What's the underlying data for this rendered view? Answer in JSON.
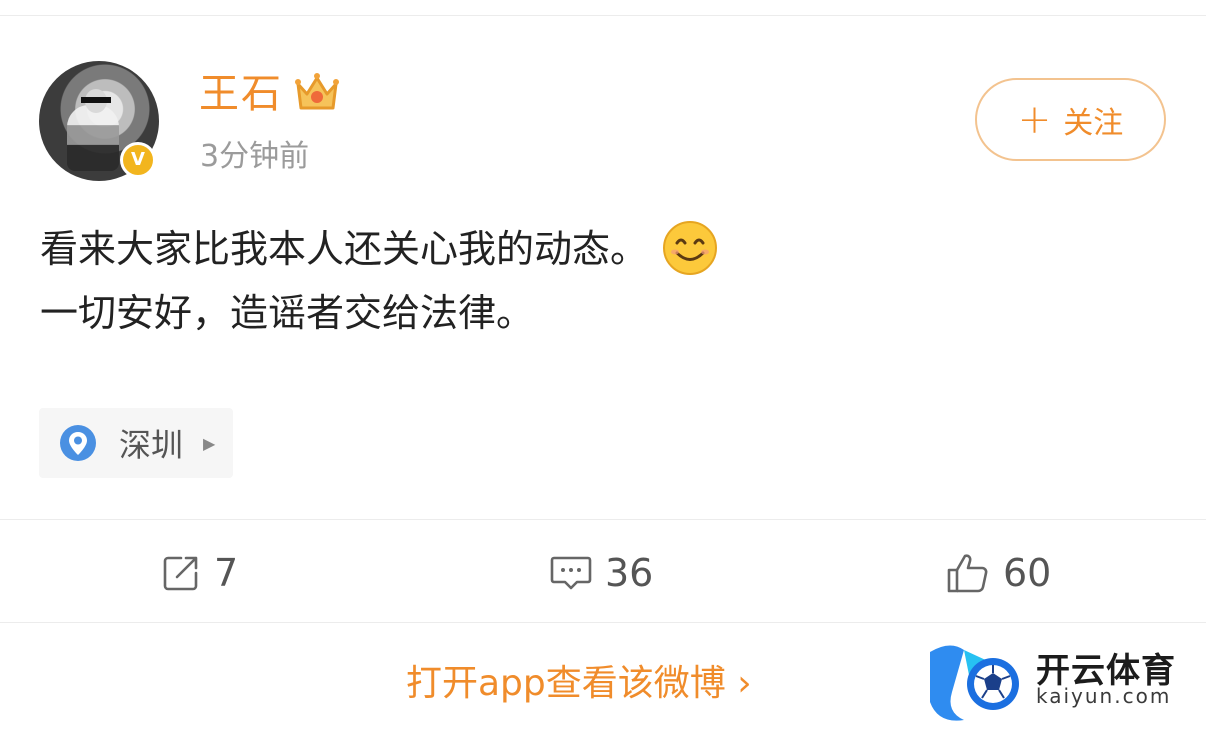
{
  "post": {
    "username": "王石",
    "timestamp": "3分钟前",
    "follow_label": "关注",
    "text_line1": "看来大家比我本人还关心我的动态。",
    "text_line2": "一切安好，造谣者交给法律。",
    "location": "深圳",
    "verified_badge": "V"
  },
  "actions": {
    "repost_count": "7",
    "comment_count": "36",
    "like_count": "60"
  },
  "footer": {
    "open_app_label": "打开app查看该微博 ›"
  },
  "watermark": {
    "brand": "开云体育",
    "domain": "kaiyun.com"
  },
  "colors": {
    "accent": "#f08c2b",
    "verified": "#f2b51e",
    "location_pin": "#4a90e2",
    "text": "#222222",
    "muted": "#9b9b9b"
  },
  "icons": [
    "crown-icon",
    "verified-icon",
    "plus-icon",
    "smile-icon",
    "location-pin-icon",
    "chevron-right-icon",
    "repost-icon",
    "comment-icon",
    "like-icon"
  ]
}
